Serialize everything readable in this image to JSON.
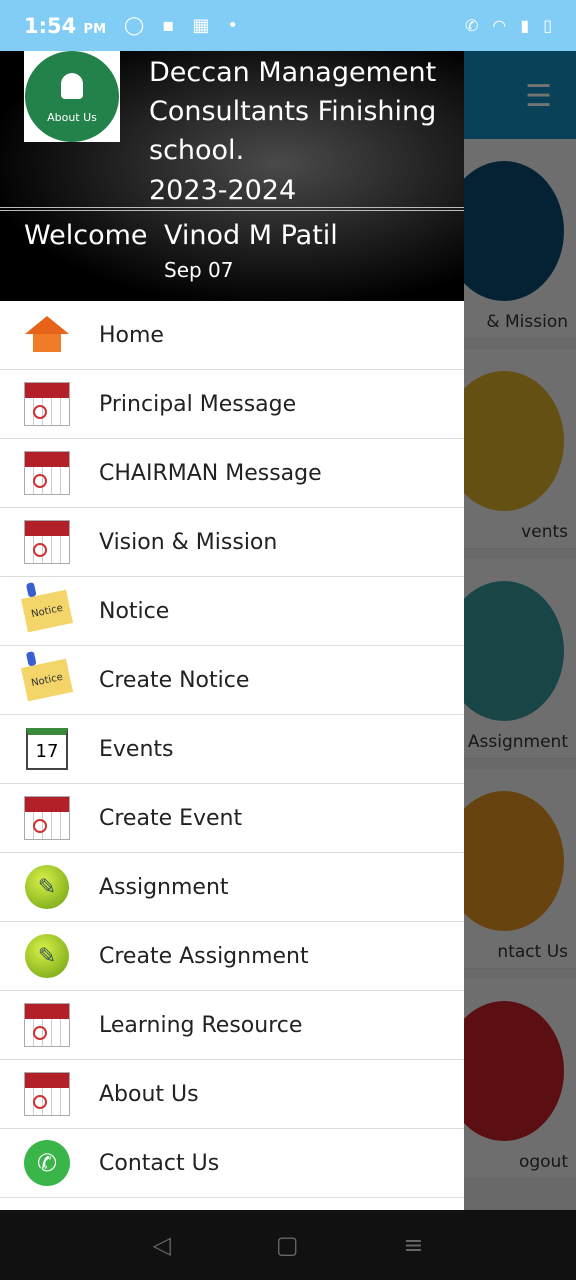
{
  "status_bar": {
    "time": "1:54",
    "ampm": "PM"
  },
  "background_cards": [
    {
      "label": "& Mission",
      "color": "#0d4d74"
    },
    {
      "label": "vents",
      "color": "#e0b12a"
    },
    {
      "label": "Assignment",
      "color": "#3a9a9e"
    },
    {
      "label": "ntact Us",
      "color": "#e39522"
    },
    {
      "label": "ogout",
      "color": "#cc2229"
    }
  ],
  "drawer": {
    "logo_text": "About Us",
    "title": "Deccan Management Consultants Finishing school.",
    "year": "2023-2024",
    "welcome": "Welcome",
    "user_name": "Vinod M Patil",
    "date": "Sep 07",
    "items": [
      {
        "label": "Home",
        "icon": "home"
      },
      {
        "label": "Principal Message",
        "icon": "calendar"
      },
      {
        "label": "CHAIRMAN Message",
        "icon": "calendar"
      },
      {
        "label": "Vision & Mission",
        "icon": "calendar"
      },
      {
        "label": "Notice",
        "icon": "notice"
      },
      {
        "label": "Create Notice",
        "icon": "notice"
      },
      {
        "label": "Events",
        "icon": "events",
        "icon_text": "17"
      },
      {
        "label": "Create Event",
        "icon": "calendar"
      },
      {
        "label": "Assignment",
        "icon": "green-ball"
      },
      {
        "label": "Create Assignment",
        "icon": "green-ball"
      },
      {
        "label": "Learning Resource",
        "icon": "calendar"
      },
      {
        "label": "About Us",
        "icon": "calendar"
      },
      {
        "label": "Contact Us",
        "icon": "phone"
      }
    ]
  },
  "notice_icon_text": "Notice"
}
